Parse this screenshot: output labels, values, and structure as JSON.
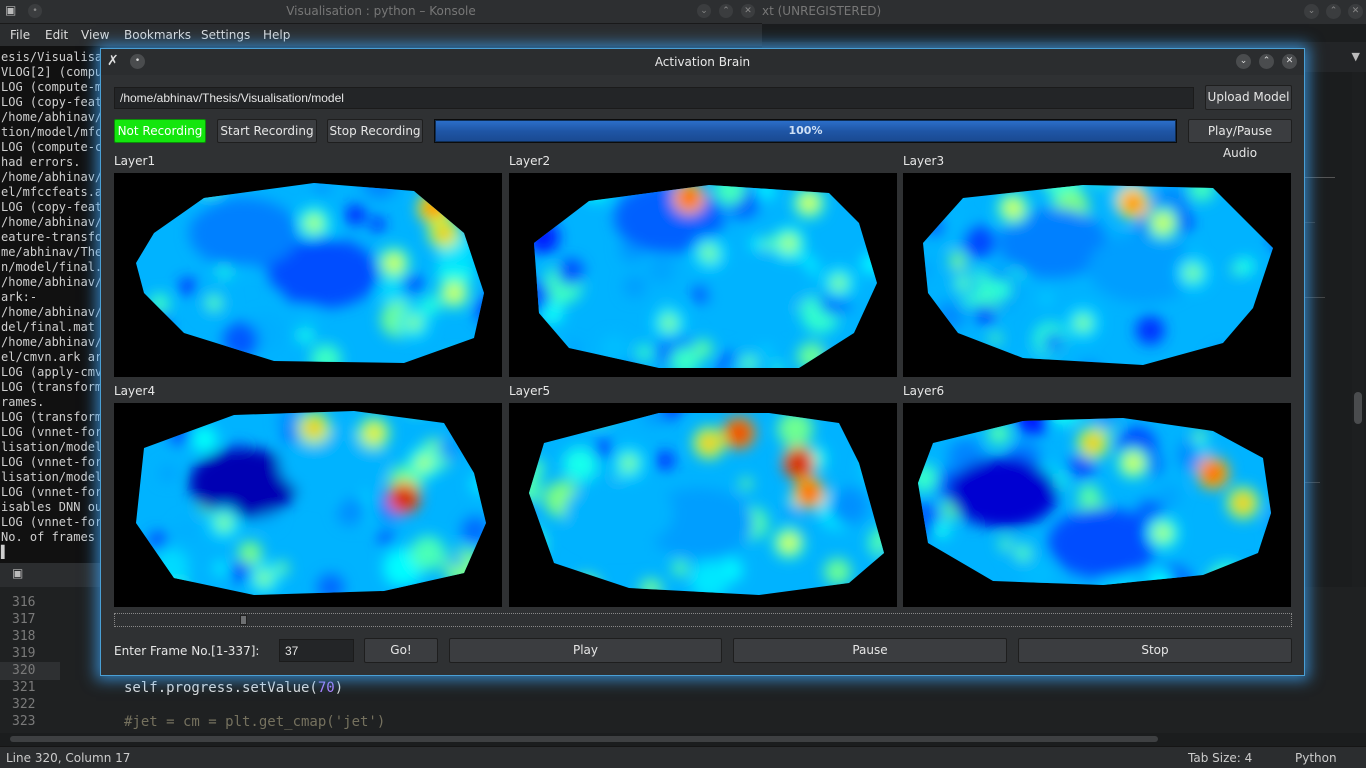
{
  "konsole": {
    "title": "Visualisation : python – Konsole",
    "menu": [
      "File",
      "Edit",
      "View",
      "Bookmarks",
      "Settings",
      "Help"
    ],
    "lines": [
      "esis/Visualisa",
      "VLOG[2] (compu",
      "LOG (compute-m",
      "LOG (copy-feat",
      "/home/abhinav/",
      "tion/model/mfc",
      "LOG (compute-c",
      " had errors.",
      "/home/abhinav/",
      "el/mfccfeats.a",
      "LOG (copy-feat",
      "/home/abhinav/",
      "eature-transfo",
      "me/abhinav/The",
      "n/model/final.",
      "/home/abhinav/",
      " ark:-",
      "/home/abhinav/",
      "del/final.mat",
      "/home/abhinav/",
      "el/cmvn.ark ar",
      "LOG (apply-cmv",
      "LOG (transform",
      "rames.",
      "LOG (transform",
      "LOG (vnnet-for",
      "lisation/model",
      "LOG (vnnet-for",
      "lisation/model",
      "LOG (vnnet-for",
      "isables DNN ou",
      "LOG (vnnet-for",
      "No. of frames",
      "▌"
    ]
  },
  "sublime": {
    "title": "xt (UNREGISTERED)",
    "gutter": [
      "316",
      "317",
      "318",
      "319",
      "320",
      "321",
      "322",
      "323"
    ],
    "highlight_line": "320",
    "code": {
      "line321_prefix": "self.progress.setValue(",
      "line321_num": "70",
      "line321_suffix": ")",
      "line323": "#jet = cm = plt.get_cmap('jet')"
    },
    "status": {
      "position": "Line 320, Column 17",
      "tab_size": "Tab Size: 4",
      "syntax": "Python"
    }
  },
  "dialog": {
    "title": "Activation Brain",
    "model_path": "/home/abhinav/Thesis/Visualisation/model",
    "upload_label": "Upload Model",
    "status_label": "Not Recording",
    "status_color": "#14e60e",
    "start_label": "Start Recording",
    "stop_label": "Stop Recording",
    "progress_value": 100,
    "progress_text": "100%",
    "play_pause_audio_label": "Play/Pause Audio",
    "layers": [
      "Layer1",
      "Layer2",
      "Layer3",
      "Layer4",
      "Layer5",
      "Layer6"
    ],
    "frame_label": "Enter Frame No.[1-337]:",
    "frame_value": "37",
    "frame_max": 337,
    "go_label": "Go!",
    "play_label": "Play",
    "pause_label": "Pause",
    "stop_label2": "Stop",
    "colormap": "jet"
  }
}
